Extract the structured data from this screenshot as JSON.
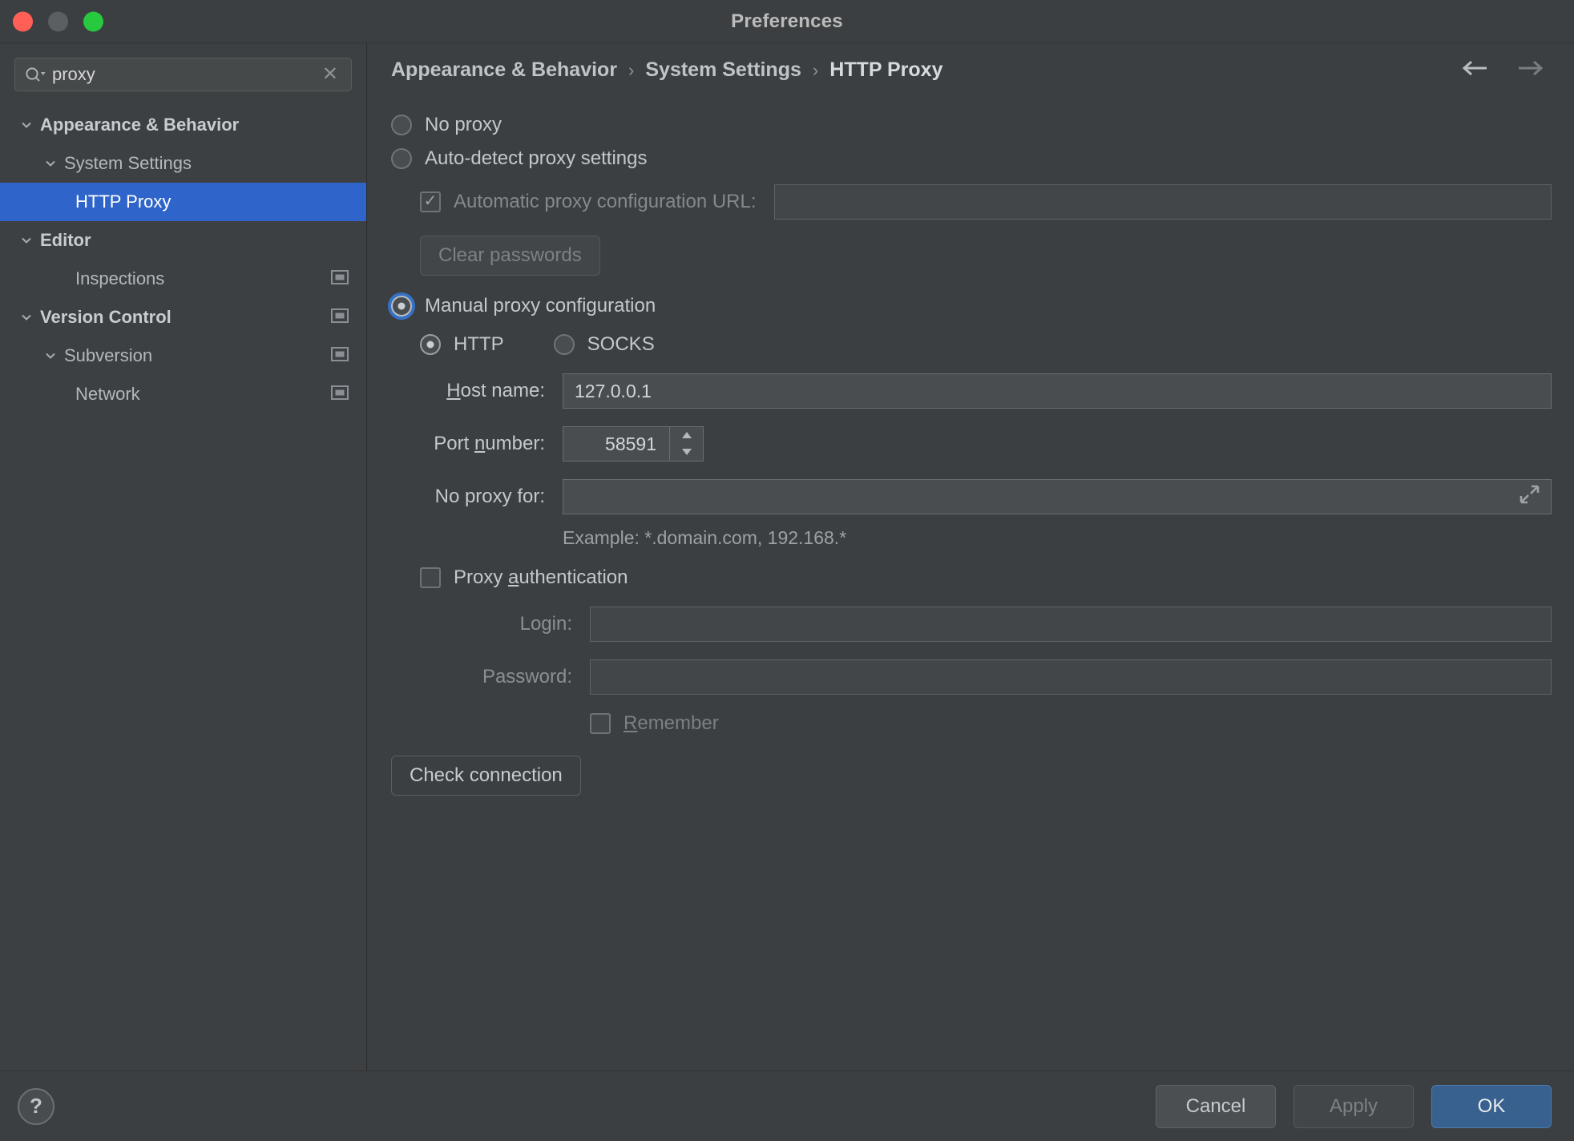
{
  "window": {
    "title": "Preferences",
    "traffic_lights": [
      "close-red",
      "minimize-gray",
      "maximize-green"
    ]
  },
  "sidebar": {
    "search": {
      "value": "proxy",
      "placeholder": "",
      "icon": "search-icon",
      "clear_icon": "clear-icon"
    },
    "items": [
      {
        "label": "Appearance & Behavior",
        "indent": 0,
        "twisty": "chevron-down-icon",
        "bold": true,
        "selected": false,
        "row_icon": false
      },
      {
        "label": "System Settings",
        "indent": 1,
        "twisty": "chevron-down-icon",
        "bold": false,
        "selected": false,
        "row_icon": false
      },
      {
        "label": "HTTP Proxy",
        "indent": 2,
        "twisty": "",
        "bold": false,
        "selected": true,
        "row_icon": false
      },
      {
        "label": "Editor",
        "indent": 0,
        "twisty": "chevron-down-icon",
        "bold": true,
        "selected": false,
        "row_icon": false
      },
      {
        "label": "Inspections",
        "indent": 1,
        "twisty": "",
        "bold": false,
        "selected": false,
        "row_icon": true
      },
      {
        "label": "Version Control",
        "indent": 0,
        "twisty": "chevron-down-icon",
        "bold": true,
        "selected": false,
        "row_icon": true
      },
      {
        "label": "Subversion",
        "indent": 1,
        "twisty": "chevron-down-icon",
        "bold": false,
        "selected": false,
        "row_icon": true
      },
      {
        "label": "Network",
        "indent": 2,
        "twisty": "",
        "bold": false,
        "selected": false,
        "row_icon": true
      }
    ]
  },
  "breadcrumb": {
    "items": [
      "Appearance & Behavior",
      "System Settings",
      "HTTP Proxy"
    ],
    "separator": "›",
    "back_icon": "arrow-left-icon",
    "forward_icon": "arrow-right-icon"
  },
  "form": {
    "no_proxy": {
      "label": "No proxy",
      "checked": false
    },
    "auto_detect": {
      "label": "Auto-detect proxy settings",
      "checked": false
    },
    "pac_url": {
      "label": "Automatic proxy configuration URL:",
      "checked": true,
      "disabled": true,
      "value": ""
    },
    "clear_passwords": {
      "label": "Clear passwords",
      "disabled": true
    },
    "manual": {
      "label": "Manual proxy configuration",
      "checked": true,
      "focused": true
    },
    "protocol": {
      "http": {
        "label": "HTTP",
        "checked": true
      },
      "socks": {
        "label": "SOCKS",
        "checked": false
      }
    },
    "host": {
      "label": "Host name:",
      "mnemonic": "H",
      "value": "127.0.0.1"
    },
    "port": {
      "label": "Port number:",
      "mnemonic": "n",
      "value": "58591",
      "spinner_icons": [
        "caret-up-icon",
        "caret-down-icon"
      ]
    },
    "no_proxy_for": {
      "label": "No proxy for:",
      "value": "",
      "expand_icon": "expand-icon"
    },
    "example": "Example: *.domain.com, 192.168.*",
    "proxy_auth": {
      "label": "Proxy authentication",
      "mnemonic": "a",
      "checked": false
    },
    "login": {
      "label": "Login:",
      "value": "",
      "disabled": true
    },
    "password": {
      "label": "Password:",
      "value": "",
      "disabled": true
    },
    "remember": {
      "label": "Remember",
      "mnemonic": "R",
      "checked": false,
      "disabled": true
    },
    "check_connection": {
      "label": "Check connection"
    }
  },
  "footer": {
    "help": {
      "label": "?",
      "icon": "help-icon"
    },
    "cancel": {
      "label": "Cancel"
    },
    "apply": {
      "label": "Apply",
      "disabled": true
    },
    "ok": {
      "label": "OK",
      "primary": true
    }
  },
  "colors": {
    "accent": "#2f65ca",
    "primary_button": "#38618f",
    "background": "#3c3f41",
    "sidebar": "#3c4043",
    "field": "#4a4d4f"
  }
}
